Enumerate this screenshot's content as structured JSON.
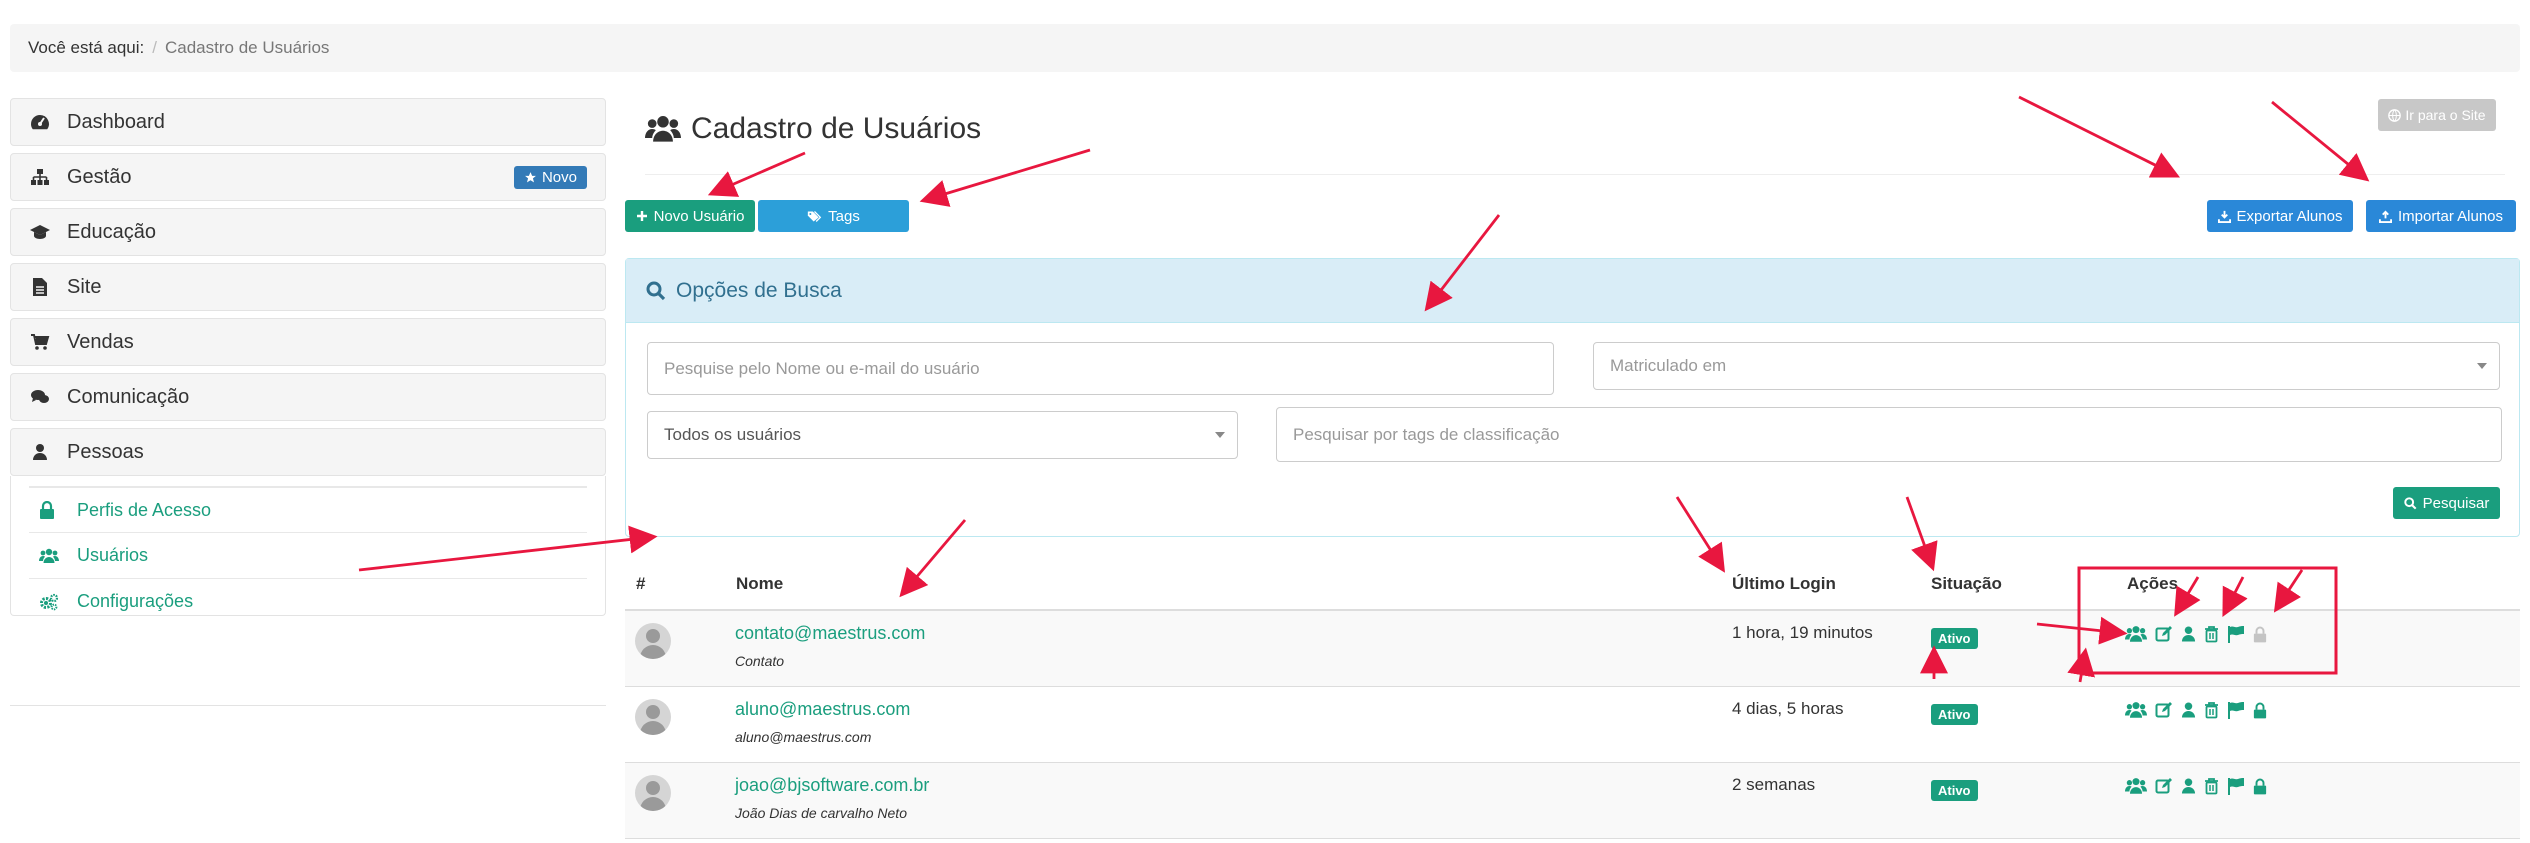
{
  "breadcrumb": {
    "prefix": "Você está aqui:",
    "separator": "/",
    "current": "Cadastro de Usuários"
  },
  "sidebar": {
    "items": [
      {
        "label": "Dashboard",
        "icon": "dashboard-icon"
      },
      {
        "label": "Gestão",
        "icon": "sitemap-icon",
        "badge": "Novo"
      },
      {
        "label": "Educação",
        "icon": "graduation-cap-icon"
      },
      {
        "label": "Site",
        "icon": "document-icon"
      },
      {
        "label": "Vendas",
        "icon": "cart-icon"
      },
      {
        "label": "Comunicação",
        "icon": "chat-icon"
      },
      {
        "label": "Pessoas",
        "icon": "user-icon"
      }
    ],
    "subitems": [
      {
        "label": "Perfis de Acesso",
        "icon": "lock-icon"
      },
      {
        "label": "Usuários",
        "icon": "users-icon"
      },
      {
        "label": "Configurações",
        "icon": "cogs-icon"
      }
    ]
  },
  "header": {
    "title": "Cadastro de Usuários",
    "site_button": "Ir para o Site"
  },
  "toolbar": {
    "new_user": "Novo Usuário",
    "tags": "Tags",
    "export": "Exportar Alunos",
    "import": "Importar Alunos"
  },
  "search": {
    "title": "Opções de Busca",
    "name_placeholder": "Pesquise pelo Nome ou e-mail do usuário",
    "enrolled_placeholder": "Matriculado em",
    "users_filter": "Todos os usuários",
    "tags_placeholder": "Pesquisar por tags de classificação",
    "submit": "Pesquisar"
  },
  "table": {
    "columns": {
      "num": "#",
      "name": "Nome",
      "last_login": "Último Login",
      "status": "Situação",
      "actions": "Ações"
    },
    "rows": [
      {
        "email": "contato@maestrus.com",
        "name": "Contato",
        "last_login": "1 hora, 19 minutos",
        "status": "Ativo",
        "lock_enabled": false
      },
      {
        "email": "aluno@maestrus.com",
        "name": "aluno@maestrus.com",
        "last_login": "4 dias, 5 horas",
        "status": "Ativo",
        "lock_enabled": true
      },
      {
        "email": "joao@bjsoftware.com.br",
        "name": "João Dias de carvalho Neto",
        "last_login": "2 semanas",
        "status": "Ativo",
        "lock_enabled": true
      }
    ],
    "action_icons": [
      "users-icon",
      "edit-icon",
      "user-icon",
      "trash-icon",
      "flag-icon",
      "lock-icon"
    ]
  },
  "colors": {
    "accent_green": "#1a9e7e",
    "accent_blue": "#2a88d8",
    "annotation_red": "#e8173f"
  }
}
